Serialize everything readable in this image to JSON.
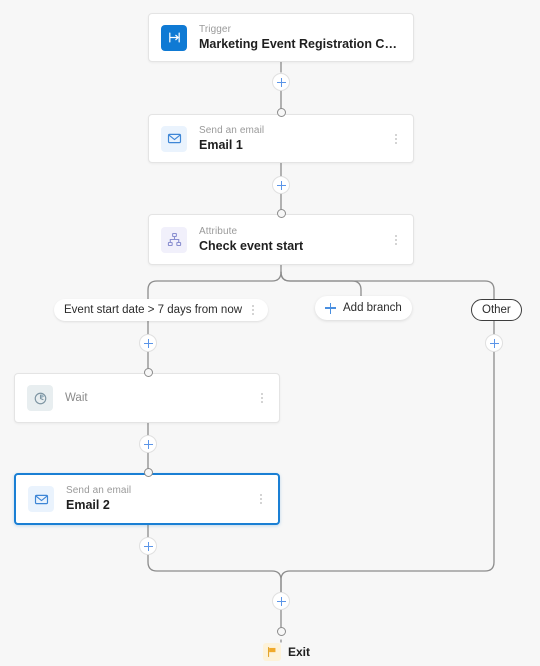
{
  "canvas": {
    "background": "#f7f7f7",
    "wire_color": "#8c8c8c",
    "accent": "#1a7fd4",
    "plus_color": "#5b95e8"
  },
  "nodes": {
    "trigger": {
      "kind": "Trigger",
      "title": "Marketing Event Registration Created",
      "icon": "trigger-arrow-icon",
      "icon_bg": "#0f7ad4",
      "selected": false
    },
    "email1": {
      "kind": "Send an email",
      "title": "Email 1",
      "icon": "envelope-icon",
      "icon_bg": "#eaf3fd",
      "selected": false
    },
    "attribute": {
      "kind": "Attribute",
      "title": "Check event start",
      "icon": "hierarchy-icon",
      "icon_bg": "#f1f0fb",
      "selected": false
    },
    "wait": {
      "kind": "",
      "title": "Wait",
      "icon": "clock-icon",
      "icon_bg": "#e8eef0",
      "selected": false
    },
    "email2": {
      "kind": "Send an email",
      "title": "Email 2",
      "icon": "envelope-icon",
      "icon_bg": "#eaf3fd",
      "selected": true
    },
    "exit": {
      "title": "Exit",
      "icon": "flag-icon",
      "icon_bg": "#fdf2d9"
    }
  },
  "branches": [
    {
      "id": "condition",
      "label": "Event start date > 7 days from now",
      "style": "filled",
      "has_menu": true
    },
    {
      "id": "add-branch",
      "label": "Add branch",
      "style": "add",
      "has_menu": false
    },
    {
      "id": "other",
      "label": "Other",
      "style": "outlined",
      "has_menu": false
    }
  ],
  "add_step_buttons": [
    {
      "id": "after-trigger",
      "label": "+"
    },
    {
      "id": "after-email1",
      "label": "+"
    },
    {
      "id": "branch-condition",
      "label": "+"
    },
    {
      "id": "branch-other",
      "label": "+"
    },
    {
      "id": "after-wait",
      "label": "+"
    },
    {
      "id": "after-email2",
      "label": "+"
    },
    {
      "id": "before-exit",
      "label": "+"
    }
  ]
}
